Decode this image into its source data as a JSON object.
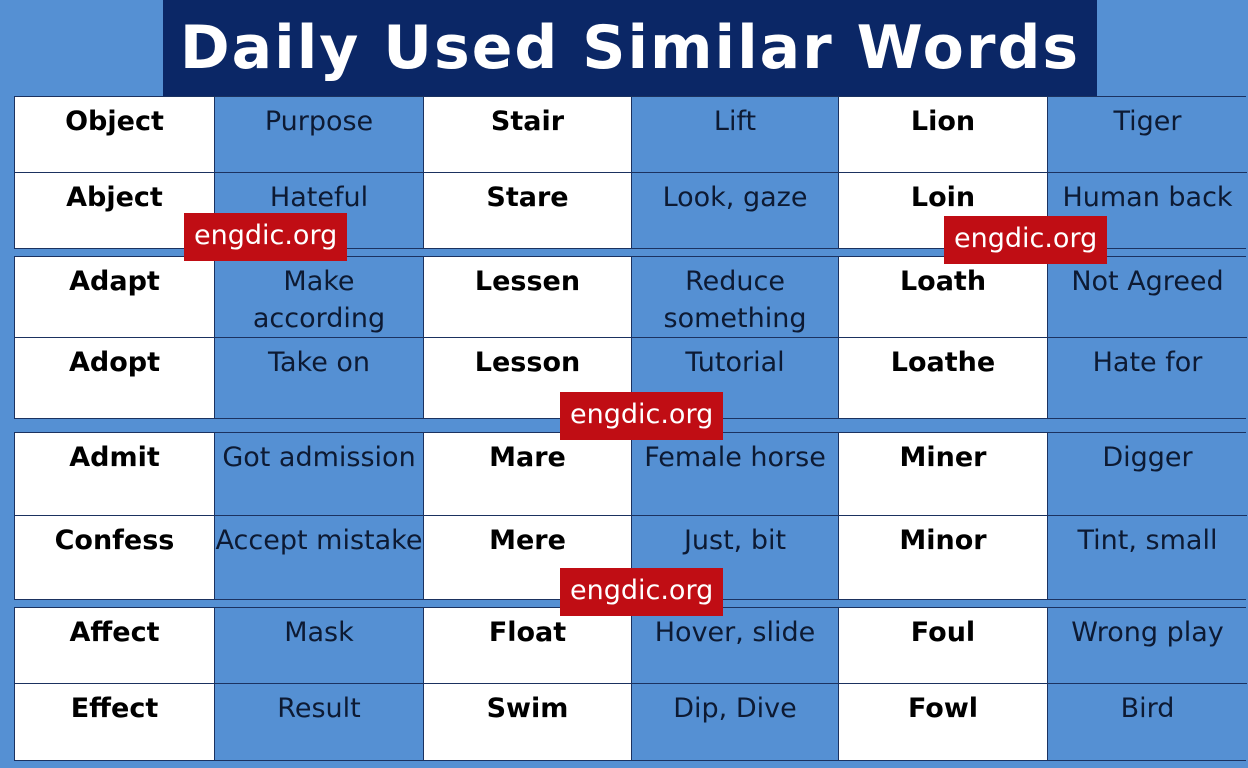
{
  "title": "Daily Used Similar Words",
  "colors": {
    "background": "#5590d3",
    "title_banner": "#0b2766",
    "word_cell": "#ffffff",
    "meaning_cell": "#5590d3",
    "watermark": "#c00d14"
  },
  "blocks": [
    {
      "rows": [
        [
          {
            "word": "Object",
            "meaning": "Purpose"
          },
          {
            "word": "Stair",
            "meaning": "Lift"
          },
          {
            "word": "Lion",
            "meaning": "Tiger"
          }
        ],
        [
          {
            "word": "Abject",
            "meaning": "Hateful"
          },
          {
            "word": "Stare",
            "meaning": "Look, gaze"
          },
          {
            "word": "Loin",
            "meaning": "Human back"
          }
        ]
      ]
    },
    {
      "rows": [
        [
          {
            "word": "Adapt",
            "meaning": "Make according"
          },
          {
            "word": "Lessen",
            "meaning": "Reduce something"
          },
          {
            "word": "Loath",
            "meaning": "Not Agreed"
          }
        ],
        [
          {
            "word": "Adopt",
            "meaning": "Take on"
          },
          {
            "word": "Lesson",
            "meaning": "Tutorial"
          },
          {
            "word": "Loathe",
            "meaning": "Hate for"
          }
        ]
      ]
    },
    {
      "rows": [
        [
          {
            "word": "Admit",
            "meaning": "Got admission"
          },
          {
            "word": "Mare",
            "meaning": "Female horse"
          },
          {
            "word": "Miner",
            "meaning": "Digger"
          }
        ],
        [
          {
            "word": "Confess",
            "meaning": "Accept mistake"
          },
          {
            "word": "Mere",
            "meaning": "Just, bit"
          },
          {
            "word": "Minor",
            "meaning": "Tint, small"
          }
        ]
      ]
    },
    {
      "rows": [
        [
          {
            "word": "Affect",
            "meaning": "Mask"
          },
          {
            "word": "Float",
            "meaning": "Hover, slide"
          },
          {
            "word": "Foul",
            "meaning": "Wrong play"
          }
        ],
        [
          {
            "word": "Effect",
            "meaning": "Result"
          },
          {
            "word": "Swim",
            "meaning": "Dip, Dive"
          },
          {
            "word": "Fowl",
            "meaning": "Bird"
          }
        ]
      ]
    }
  ],
  "watermarks": [
    "engdic.org",
    "engdic.org",
    "engdic.org",
    "engdic.org"
  ]
}
